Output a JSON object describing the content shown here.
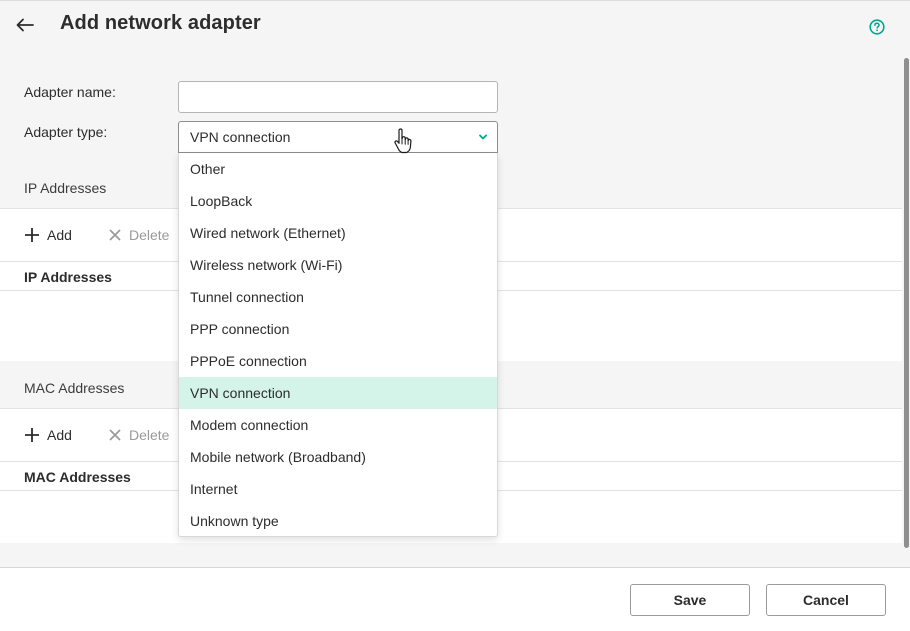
{
  "header": {
    "title": "Add network adapter",
    "back_icon": "arrow-left-icon",
    "help_icon": "question-circle-icon",
    "accent_color": "#00a88e"
  },
  "form": {
    "adapter_name_label": "Adapter name:",
    "adapter_name_value": "",
    "adapter_type_label": "Adapter type:",
    "adapter_type_value": "VPN connection"
  },
  "ip_section": {
    "title": "IP Addresses",
    "add_label": "Add",
    "delete_label": "Delete",
    "column_header": "IP Addresses"
  },
  "mac_section": {
    "title": "MAC Addresses",
    "add_label": "Add",
    "delete_label": "Delete",
    "column_header": "MAC Addresses"
  },
  "dropdown": {
    "options": [
      "Other",
      "LoopBack",
      "Wired network (Ethernet)",
      "Wireless network (Wi-Fi)",
      "Tunnel connection",
      "PPP connection",
      "PPPoE connection",
      "VPN connection",
      "Modem connection",
      "Mobile network (Broadband)",
      "Internet",
      "Unknown type"
    ],
    "selected": "VPN connection",
    "selected_color": "#d4f4ea"
  },
  "footer": {
    "save_label": "Save",
    "cancel_label": "Cancel"
  }
}
